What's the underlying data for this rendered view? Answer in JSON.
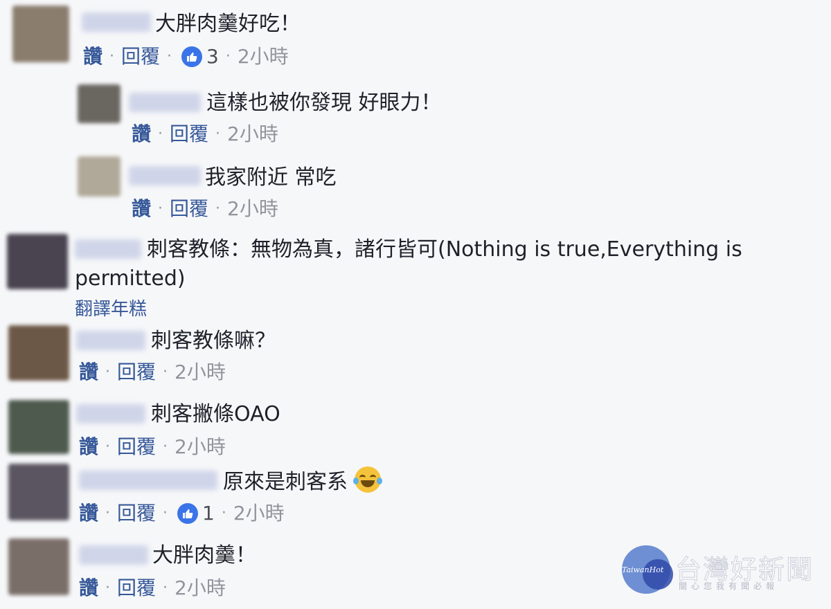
{
  "common": {
    "like_label": "讚",
    "reply_label": "回覆",
    "dot": "·"
  },
  "comments": [
    {
      "text": "大胖肉羹好吃！",
      "likes": "3",
      "time": "2小時"
    },
    {
      "text": "這樣也被你發現 好眼力！",
      "time": "2小時"
    },
    {
      "text": "我家附近 常吃",
      "time": "2小時"
    },
    {
      "text": "刺客教條：無物為真，諸行皆可(Nothing is true,Everything is permitted)",
      "translate": "翻譯年糕"
    },
    {
      "text": "刺客教條嘛？",
      "time": "2小時"
    },
    {
      "text": "刺客撇條OAO",
      "time": "2小時"
    },
    {
      "text": "原來是刺客系",
      "likes": "1",
      "time": "2小時"
    },
    {
      "text": "大胖肉羹！",
      "time": "2小時"
    }
  ],
  "watermark": {
    "logo_en": "TaiwanHot",
    "logo_zh": "台灣好新聞",
    "sub": "關心您我有聞必報"
  },
  "colors": {
    "link": "#365899",
    "like_badge": "#3b74e8",
    "background": "#f6f7f9"
  }
}
